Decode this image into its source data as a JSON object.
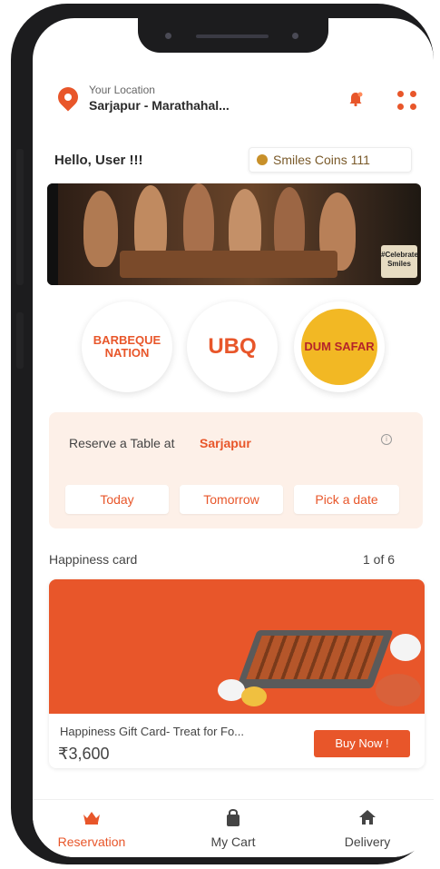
{
  "header": {
    "location_label": "Your Location",
    "location_value": "Sarjapur - Marathahal..."
  },
  "greeting": {
    "hello": "Hello,",
    "user": "User !!!"
  },
  "coins": {
    "label": "Smiles Coins 111"
  },
  "banner": {
    "tag_text": "#Celebrate Smiles"
  },
  "brands": [
    {
      "name": "BARBEQUE NATION"
    },
    {
      "name": "UBQ"
    },
    {
      "name": "DUM SAFAR"
    }
  ],
  "reserve": {
    "title": "Reserve a Table at",
    "city": "Sarjapur",
    "dates": [
      "Today",
      "Tomorrow",
      "Pick a date"
    ]
  },
  "happiness": {
    "section_title": "Happiness card",
    "page_count": "1 of 6",
    "card_name": "Happiness Gift Card- Treat for Fo...",
    "price": "₹3,600",
    "buy_label": "Buy Now !"
  },
  "tabs": [
    {
      "label": "Reservation",
      "icon": "crown-icon",
      "active": true
    },
    {
      "label": "My Cart",
      "icon": "bag-icon",
      "active": false
    },
    {
      "label": "Delivery",
      "icon": "home-icon",
      "active": false
    }
  ],
  "colors": {
    "accent": "#e8562a",
    "reserve_bg": "#fdf0e8",
    "coin": "#c8902a"
  }
}
